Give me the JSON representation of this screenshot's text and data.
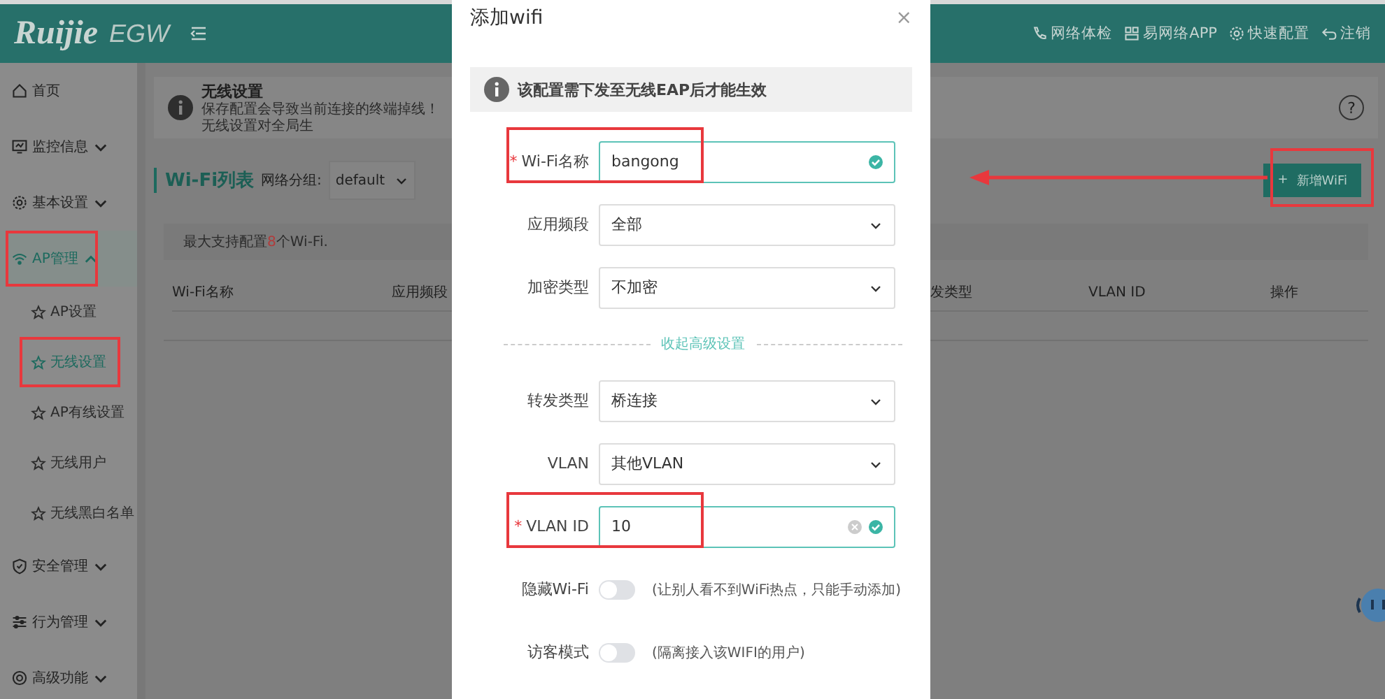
{
  "header": {
    "brand": "Ruijie",
    "product": "EGW",
    "actions": [
      {
        "label": "网络体检"
      },
      {
        "label": "易网络APP"
      },
      {
        "label": "快速配置"
      },
      {
        "label": "注销"
      }
    ]
  },
  "sidebar": {
    "items": [
      {
        "label": "首页",
        "selected": false,
        "highlighted": false
      },
      {
        "label": "监控信息",
        "expanded": false,
        "selected": false,
        "highlighted": false
      },
      {
        "label": "基本设置",
        "expanded": false,
        "selected": false,
        "highlighted": false
      },
      {
        "label": "AP管理",
        "expanded": true,
        "selected": true,
        "highlighted": true,
        "children": [
          {
            "label": "AP设置",
            "selected": false,
            "highlighted": false
          },
          {
            "label": "无线设置",
            "selected": true,
            "highlighted": true
          },
          {
            "label": "AP有线设置",
            "selected": false,
            "highlighted": false
          },
          {
            "label": "无线用户",
            "selected": false,
            "highlighted": false
          },
          {
            "label": "无线黑白名单",
            "selected": false,
            "highlighted": false
          }
        ]
      },
      {
        "label": "安全管理",
        "expanded": false,
        "selected": false,
        "highlighted": false
      },
      {
        "label": "行为管理",
        "expanded": false,
        "selected": false,
        "highlighted": false
      },
      {
        "label": "高级功能",
        "expanded": false,
        "selected": false,
        "highlighted": false
      }
    ]
  },
  "content": {
    "banner": {
      "title": "无线设置",
      "text": "保存配置会导致当前连接的终端掉线！无线设置对全局生",
      "help": "?"
    },
    "list": {
      "title": "Wi-Fi列表",
      "group_label": "网络分组:",
      "group_value": "default",
      "add_button": {
        "icon": "+",
        "label": "新增WiFi",
        "highlighted": true
      },
      "limit_note": {
        "prefix": "最大支持配置",
        "count": "8",
        "suffix": "个Wi-Fi."
      }
    },
    "table": {
      "columns": [
        "Wi-Fi名称",
        "应用频段",
        "发类型",
        "VLAN ID",
        "操作"
      ]
    }
  },
  "dialog": {
    "title": "添加wifi",
    "close": "×",
    "notice": "该配置需下发至无线EAP后才能生效",
    "fields": [
      {
        "kind": "input",
        "required_mark": "*",
        "label": "Wi-Fi名称",
        "value": "bangong",
        "valid": true,
        "clearable": false,
        "highlighted": true
      },
      {
        "kind": "select",
        "label": "应用频段",
        "value": "全部",
        "highlighted": false
      },
      {
        "kind": "select",
        "label": "加密类型",
        "value": "不加密",
        "highlighted": false
      },
      {
        "kind": "divider",
        "label": "收起高级设置"
      },
      {
        "kind": "select",
        "label": "转发类型",
        "value": "桥连接",
        "highlighted": false
      },
      {
        "kind": "select",
        "label": "VLAN",
        "value": "其他VLAN",
        "highlighted": false
      },
      {
        "kind": "input",
        "required_mark": "*",
        "label": "VLAN ID",
        "value": "10",
        "valid": true,
        "clearable": true,
        "highlighted": true
      },
      {
        "kind": "toggle",
        "label": "隐藏Wi-Fi",
        "on": false,
        "hint": "(让别人看不到WiFi热点，只能手动添加)"
      },
      {
        "kind": "toggle",
        "label": "访客模式",
        "on": false,
        "hint": "(隔离接入该WIFI的用户)"
      }
    ]
  }
}
